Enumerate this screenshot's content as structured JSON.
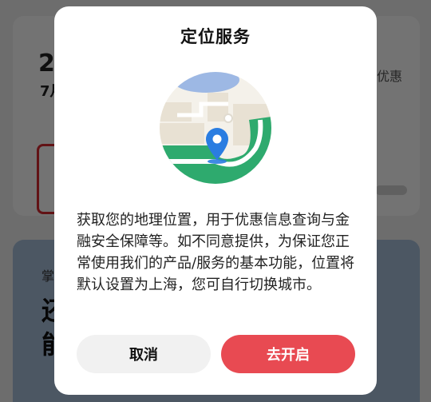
{
  "background": {
    "big_number": "2",
    "sub_text": "7月",
    "right_text": "优惠",
    "card_small_text": "掌",
    "card_big_text_1": "还",
    "card_big_text_2": "能"
  },
  "dialog": {
    "title": "定位服务",
    "illustration_icon": "location-pin-map-icon",
    "body": "获取您的地理位置，用于优惠信息查询与金融安全保障等。如不同意提供，为保证您正常使用我们的产品/服务的基本功能，位置将默认设置为上海，您可自行切换城市。",
    "cancel_label": "取消",
    "confirm_label": "去开启"
  },
  "colors": {
    "accent": "#e84a52",
    "map_green": "#2eaa6e",
    "map_blue": "#9db8e4",
    "pin_blue": "#2a7de1",
    "map_beige": "#e8e1d3"
  }
}
